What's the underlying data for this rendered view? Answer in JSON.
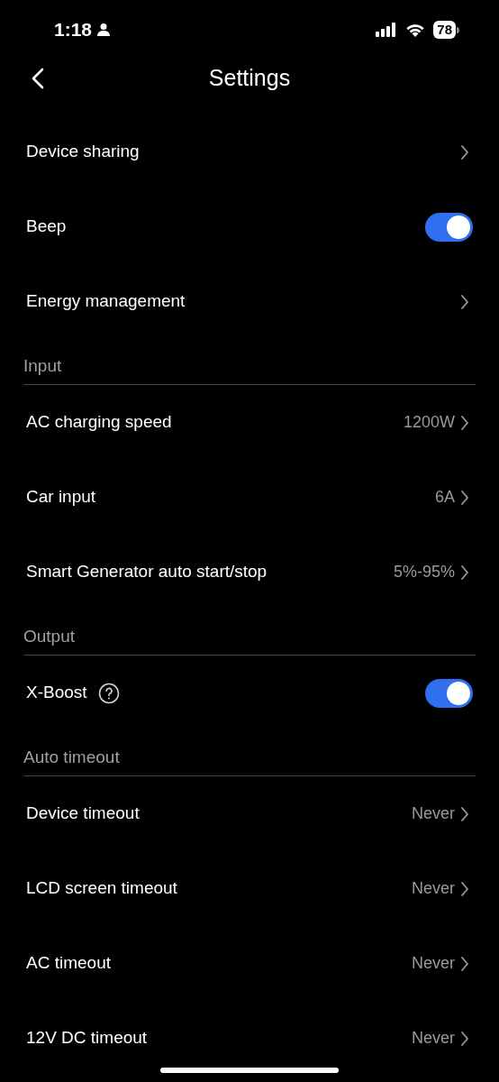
{
  "status_bar": {
    "time": "1:18",
    "battery": "78"
  },
  "header": {
    "title": "Settings"
  },
  "sections": [
    {
      "rows": [
        {
          "kind": "link",
          "label": "Device sharing"
        },
        {
          "kind": "toggle",
          "label": "Beep",
          "on": true
        },
        {
          "kind": "link",
          "label": "Energy management"
        }
      ]
    },
    {
      "title": "Input",
      "rows": [
        {
          "kind": "link",
          "label": "AC charging speed",
          "value": "1200W"
        },
        {
          "kind": "link",
          "label": "Car input",
          "value": "6A"
        },
        {
          "kind": "link",
          "label": "Smart Generator auto start/stop",
          "value": "5%-95%"
        }
      ]
    },
    {
      "title": "Output",
      "rows": [
        {
          "kind": "toggle",
          "label": "X-Boost",
          "help": true,
          "on": true
        }
      ]
    },
    {
      "title": "Auto timeout",
      "rows": [
        {
          "kind": "link",
          "label": "Device timeout",
          "value": "Never"
        },
        {
          "kind": "link",
          "label": "LCD screen timeout",
          "value": "Never"
        },
        {
          "kind": "link",
          "label": "AC timeout",
          "value": "Never"
        },
        {
          "kind": "link",
          "label": "12V DC timeout",
          "value": "Never"
        }
      ]
    }
  ]
}
